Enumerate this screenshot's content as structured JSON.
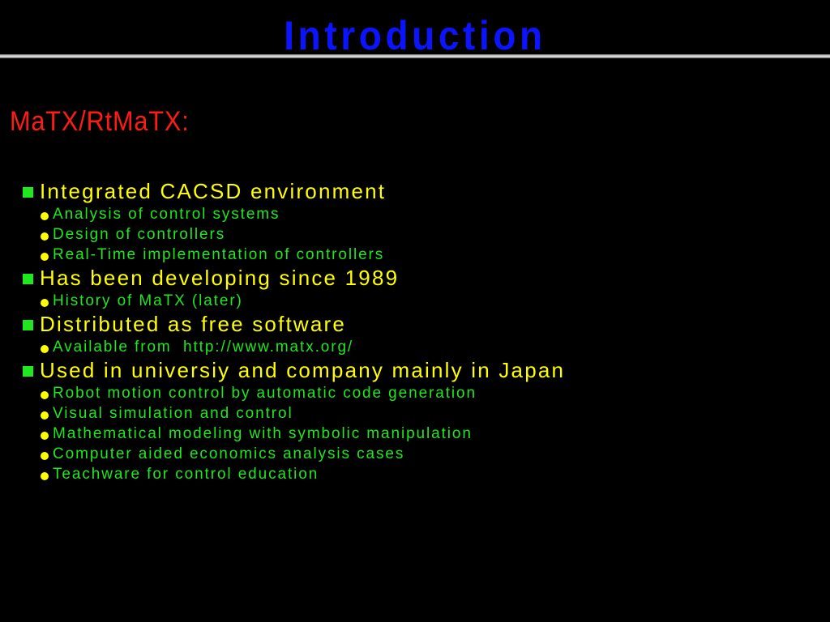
{
  "slide": {
    "title": "Introduction",
    "subtitle": "MaTX/RtMaTX:",
    "bullets": [
      {
        "text": "Integrated CACSD environment",
        "children": [
          "Analysis of control systems",
          "Design of controllers",
          "Real-Time implementation of controllers"
        ]
      },
      {
        "text": "Has been developing since 1989",
        "children": [
          "History of MaTX (later)"
        ]
      },
      {
        "text": "Distributed as free software",
        "children": [
          "Available from  http://www.matx.org/"
        ]
      },
      {
        "text": "Used in universiy and company mainly in Japan",
        "children": [
          "Robot motion control by automatic code generation",
          "Visual simulation and control",
          "Mathematical modeling with symbolic manipulation",
          "Computer aided economics analysis cases",
          "Teachware for control education"
        ]
      }
    ]
  },
  "colors": {
    "background": "#000000",
    "title": "#0a14ff",
    "subtitle": "#ff1a14",
    "level1_text": "#ffff00",
    "level1_marker": "#1ee81e",
    "level2_text": "#1ee81e",
    "level2_marker": "#ffff00"
  },
  "icons": {
    "level1_marker": "green-square-bullet-icon",
    "level2_marker": "yellow-dot-bullet-icon"
  }
}
